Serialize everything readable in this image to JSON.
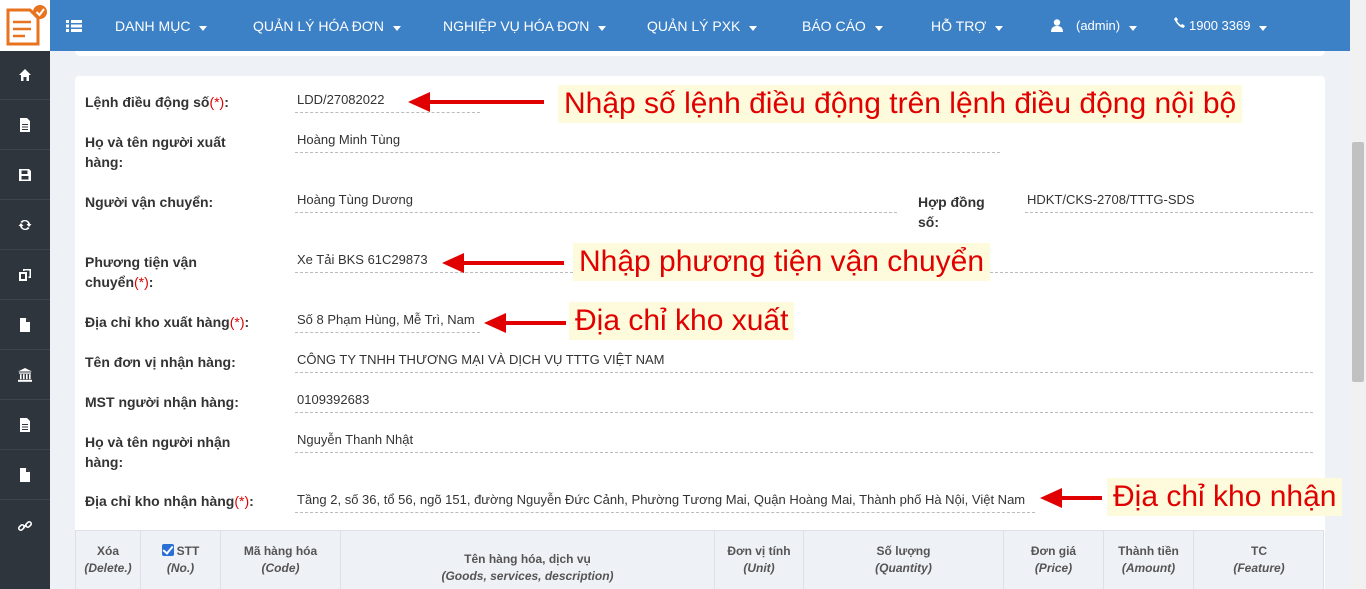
{
  "nav": {
    "menu": [
      {
        "label": "DANH MỤC"
      },
      {
        "label": "QUẢN LÝ HÓA ĐƠN"
      },
      {
        "label": "NGHIỆP VỤ HÓA ĐƠN"
      },
      {
        "label": "QUẢN LÝ PXK"
      },
      {
        "label": "BÁO CÁO"
      },
      {
        "label": "HỖ TRỢ"
      }
    ],
    "user": "(admin)",
    "phone": "1900 3369"
  },
  "sidebar": {
    "icons": [
      "home-icon",
      "file-text-icon",
      "save-icon",
      "refresh-icon",
      "copy-icon",
      "file-icon",
      "bank-icon",
      "file-text-icon",
      "file-icon",
      "link-icon"
    ]
  },
  "form": {
    "lenh_label": "Lệnh điều động số",
    "lenh_value": "LDD/27082022",
    "nguoi_xuat_label": "Họ và tên người xuất hàng:",
    "nguoi_xuat_value": "Hoàng Minh Tùng",
    "van_chuyen_label": "Người vận chuyển:",
    "van_chuyen_value": "Hoàng Tùng Dương",
    "hop_dong_label": "Hợp đồng số:",
    "hop_dong_value": "HDKT/CKS-2708/TTTG-SDS",
    "phuong_tien_label": "Phương tiện vận chuyển",
    "phuong_tien_value": "Xe Tải BKS 61C29873",
    "kho_xuat_label": "Địa chỉ kho xuất hàng",
    "kho_xuat_value": "Số 8 Phạm Hùng, Mễ Trì, Nam",
    "don_vi_label": "Tên đơn vị nhận hàng:",
    "don_vi_value": "CÔNG TY TNHH THƯƠNG MẠI VÀ DỊCH VỤ TTTG VIỆT NAM",
    "mst_label": "MST người nhận hàng:",
    "mst_value": "0109392683",
    "nguoi_nhan_label": "Họ và tên người nhận hàng:",
    "nguoi_nhan_value": "Nguyễn Thanh Nhật",
    "kho_nhan_label": "Địa chỉ kho nhận hàng",
    "kho_nhan_value": "Tầng 2, số 36, tổ 56, ngõ 151, đường Nguyễn Đức Cảnh, Phường Tương Mai, Quận Hoàng Mai, Thành phố Hà Nội, Việt Nam",
    "required_mark": "(*)",
    "colon": ":"
  },
  "annotations": {
    "lenh": "Nhập số lệnh điều động trên lệnh điều động nội bộ",
    "phuong_tien": "Nhập phương tiện vận chuyển",
    "kho_xuat": "Địa chỉ kho xuất",
    "kho_nhan": "Địa chỉ kho nhận",
    "color": "#e00000"
  },
  "table": {
    "columns": [
      {
        "label": "Xóa",
        "sub": "(Delete.)"
      },
      {
        "label": "STT",
        "sub": "(No.)"
      },
      {
        "label": "Mã hàng hóa",
        "sub": "(Code)"
      },
      {
        "label": "Tên hàng hóa, dịch vụ",
        "sub": "(Goods, services, description)"
      },
      {
        "label": "Đơn vị tính",
        "sub": "(Unit)"
      },
      {
        "label": "Số lượng",
        "sub": "(Quantity)"
      },
      {
        "label": "Đơn giá",
        "sub": "(Price)"
      },
      {
        "label": "Thành tiền",
        "sub": "(Amount)"
      },
      {
        "label": "TC",
        "sub": "(Feature)"
      }
    ]
  },
  "colors": {
    "navbar": "#3c80c6",
    "sidebar": "#2f353d",
    "required": "#d00000"
  }
}
